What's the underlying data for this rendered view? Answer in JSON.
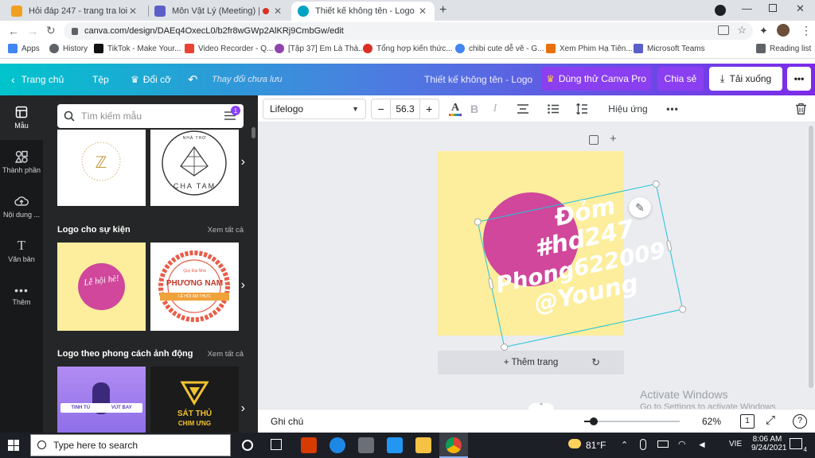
{
  "browser": {
    "tabs": [
      {
        "title": "Hỏi đáp 247 - trang tra loi",
        "color": "#f0a020"
      },
      {
        "title": "Môn Vật Lý (Meeting) | Micro",
        "color": "#5b5fc7"
      },
      {
        "title": "Thiết kế không tên - Logo",
        "color": "#00a3c4"
      }
    ],
    "url": "canva.com/design/DAEq4OxecL0/b2fr8wGWp2AlKRj9CmbGw/edit",
    "bookmarks": [
      {
        "label": "Apps",
        "color": "#4285f4"
      },
      {
        "label": "History",
        "color": "#5f6368"
      },
      {
        "label": "TikTok - Make Your...",
        "color": "#111111"
      },
      {
        "label": "Video Recorder - Q...",
        "color": "#ea4335"
      },
      {
        "label": "[Tập 37] Em Là Thà...",
        "color": "#8e44ad"
      },
      {
        "label": "Tổng hợp kiến thức...",
        "color": "#d93025"
      },
      {
        "label": "chibi cute dễ vẽ - G...",
        "color": "#4285f4"
      },
      {
        "label": "Xem Phim Hạ Tiên...",
        "color": "#e8710a"
      },
      {
        "label": "Microsoft Teams",
        "color": "#5b5fc7"
      }
    ],
    "reading_list": "Reading list"
  },
  "header": {
    "home": "Trang chủ",
    "file": "Tệp",
    "resize": "Đổi cỡ",
    "unsaved": "Thay đổi chưa lưu",
    "doc_title": "Thiết kế không tên - Logo",
    "try_pro": "Dùng thử Canva Pro",
    "share": "Chia sẻ",
    "download": "Tải xuống"
  },
  "rail": [
    {
      "label": "Mẫu"
    },
    {
      "label": "Thành phần"
    },
    {
      "label": "Nội dung ..."
    },
    {
      "label": "Văn bản"
    },
    {
      "label": "Thêm"
    }
  ],
  "panel": {
    "search_placeholder": "Tìm kiếm mẫu",
    "filter_badge": "1",
    "sections": [
      {
        "title": "Logo cho sự kiện",
        "link": "Xem tất cả"
      },
      {
        "title": "Logo theo phong cách ảnh động",
        "link": "Xem tất cả"
      }
    ],
    "thumbs": {
      "t1": "CHA TAM",
      "t2_top": "NHÀ THƠ",
      "t3": "Lễ hội hè!",
      "t4_top": "Quy Đại Nhà",
      "t4_main": "PHƯƠNG NAM",
      "t4_ribbon": "LỄ HỘI ẨM THỰC",
      "t5_left": "TINH TÚ",
      "t5_right": "VÚT BAY",
      "t6_line1": "SÁT THỦ",
      "t6_line2": "CHIM ƯNG"
    }
  },
  "toolbar": {
    "font": "Lifelogo",
    "size": "56.3",
    "bold": "B",
    "italic": "I",
    "effects": "Hiệu ứng"
  },
  "design": {
    "line1": "Đỏm",
    "line2": "#hd247",
    "line3": "Phong622009",
    "line4": "@Young",
    "add_page": "+ Thêm trang"
  },
  "watermark": {
    "title": "Activate Windows",
    "subtitle": "Go to Settings to activate Windows."
  },
  "bottom": {
    "notes": "Ghi chú",
    "zoom": "62%",
    "page": "1",
    "zoom_level": 0.1
  },
  "taskbar": {
    "search_placeholder": "Type here to search",
    "weather": "81°F",
    "lang": "VIE",
    "time": "8:06 AM",
    "date": "9/24/2021",
    "notif": "4"
  },
  "colors": {
    "design_bg": "#fdee9d",
    "circle": "#d0479b",
    "selection": "#21c4d6",
    "pro_button": "#7d2ae8"
  }
}
